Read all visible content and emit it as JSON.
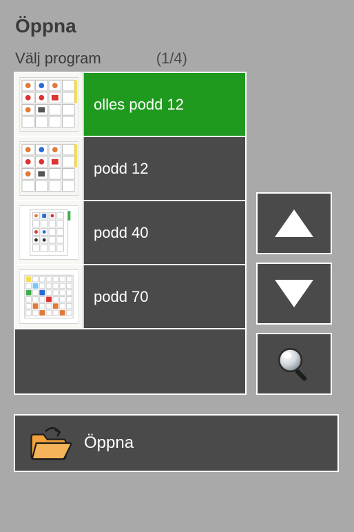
{
  "title": "Öppna",
  "subhead": {
    "label": "Välj program",
    "counter": "(1/4)"
  },
  "list": {
    "items": [
      {
        "label": "olles podd 12",
        "selected": true,
        "thumb": "grid-small"
      },
      {
        "label": "podd 12",
        "selected": false,
        "thumb": "grid-small"
      },
      {
        "label": "podd 40",
        "selected": false,
        "thumb": "grid-page"
      },
      {
        "label": "podd 70",
        "selected": false,
        "thumb": "grid-dense"
      }
    ],
    "empty_rows": 1
  },
  "side": {
    "up_icon": "triangle-up",
    "down_icon": "triangle-down",
    "search_icon": "magnifier"
  },
  "open_button": {
    "label": "Öppna",
    "icon": "folder-open"
  }
}
